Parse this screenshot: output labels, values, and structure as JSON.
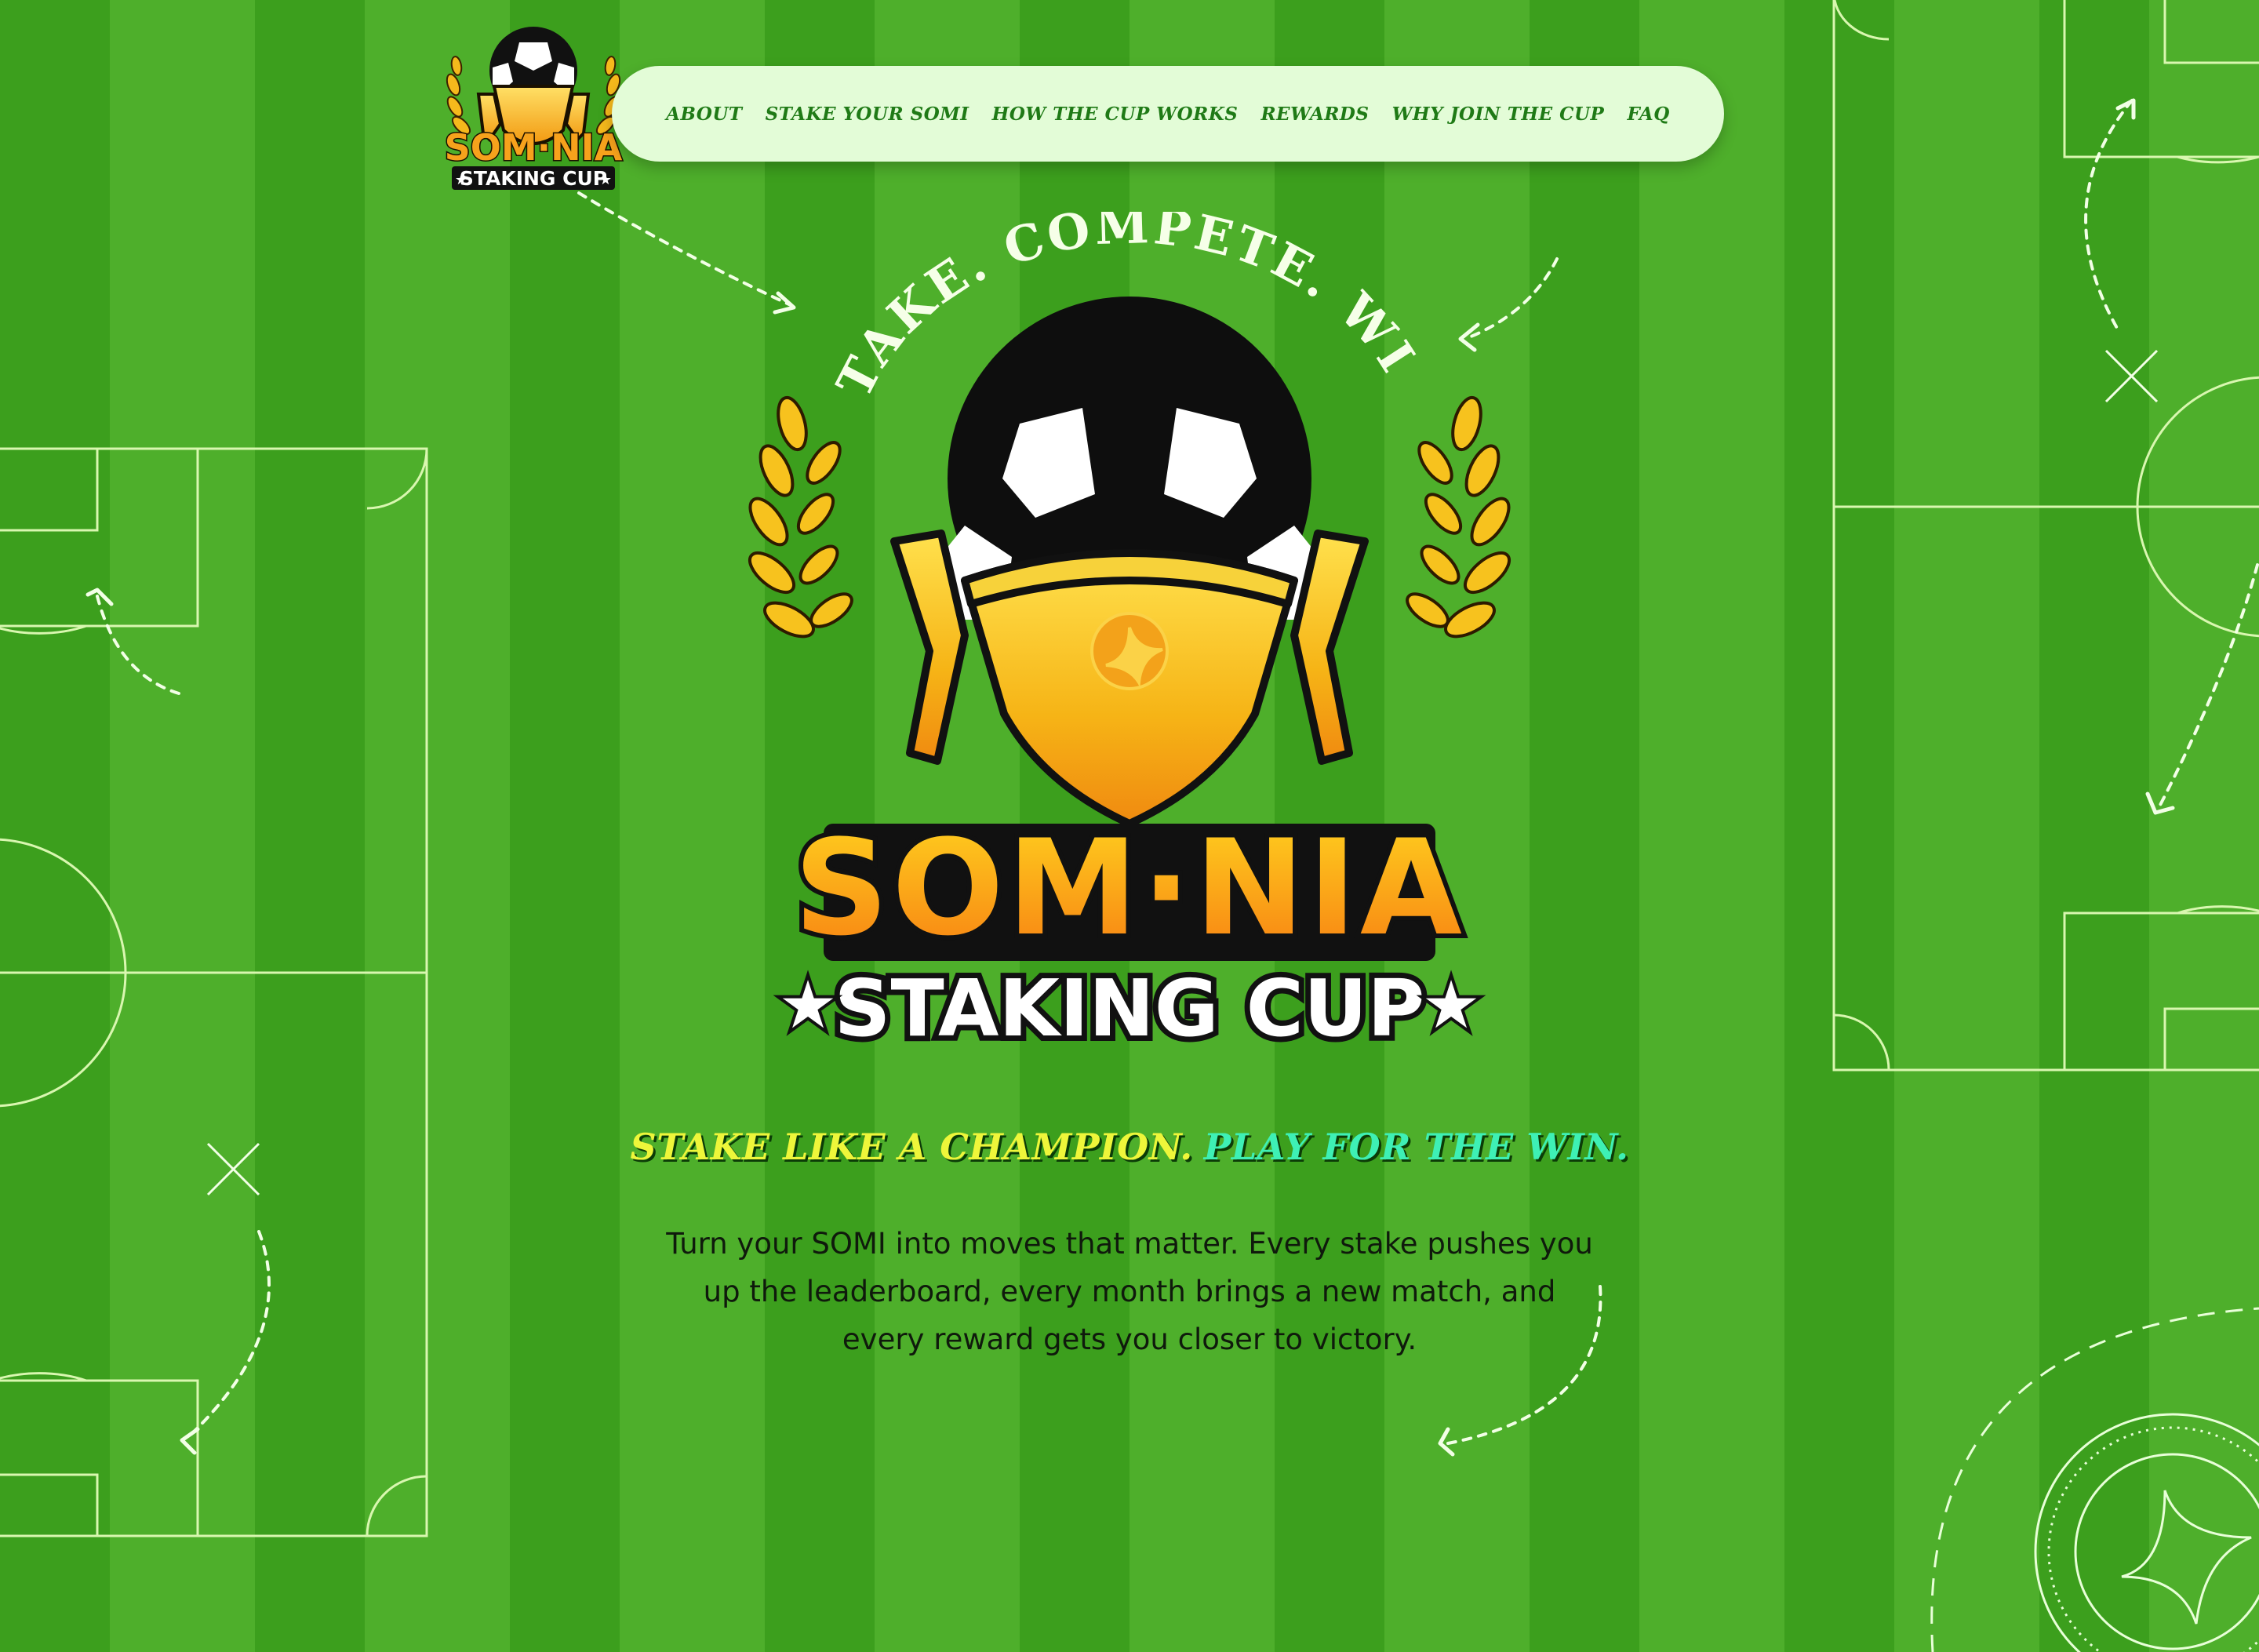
{
  "nav": {
    "logo": {
      "title": "SOM·NIA",
      "subtitle": "STAKING CUP"
    },
    "links": [
      {
        "label": "ABOUT"
      },
      {
        "label": "STAKE YOUR SOMI"
      },
      {
        "label": "HOW THE CUP WORKS"
      },
      {
        "label": "REWARDS"
      },
      {
        "label": "WHY JOIN THE CUP"
      },
      {
        "label": "FAQ"
      }
    ]
  },
  "hero": {
    "arc_text": "STAKE. COMPETE. WIN.",
    "logo_title": "SOM·NIA",
    "logo_subtitle": "STAKING CUP",
    "tagline_part1": "STAKE LIKE A CHAMPION.",
    "tagline_part2": "PLAY FOR THE WIN.",
    "intro": "Turn your SOMI into moves that matter. Every stake pushes you up the leaderboard, every month brings a new match, and every reward gets you closer to victory."
  },
  "colors": {
    "field_dark": "#3c9f1d",
    "field_light": "#4eaf2b",
    "nav_bg": "#e3fcd7",
    "nav_text": "#1f7a16",
    "gold": "#f5b21a",
    "orange": "#f7931e",
    "tagline_yellow": "#eef63a",
    "tagline_mint": "#3ef0b5"
  },
  "icons": [
    "soccer-ball-icon",
    "trophy-icon",
    "laurel-icon",
    "star-icon",
    "somnia-mark-icon",
    "cross-marker-icon",
    "dashed-arrow-icon"
  ]
}
